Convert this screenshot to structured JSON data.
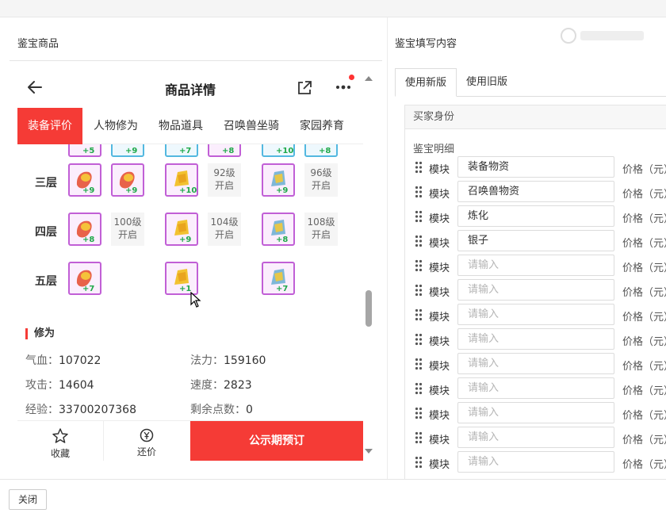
{
  "left_panel": {
    "title": "鉴宝商品"
  },
  "right_panel": {
    "title": "鉴宝填写内容"
  },
  "phone": {
    "nav_title": "商品详情",
    "tabs": [
      "装备评价",
      "人物修为",
      "物品道具",
      "召唤兽坐骑",
      "家园养育"
    ],
    "active_tab": "装备评价",
    "rows": [
      {
        "label": "",
        "items": [
          "+5",
          "+9",
          "+7",
          "+8",
          "+10",
          "+8"
        ]
      },
      {
        "label": "三层",
        "items": [
          "+9",
          "+9",
          "+10",
          "+9"
        ],
        "locked": [
          "92级开启",
          "96级开启"
        ]
      },
      {
        "label": "四层",
        "items": [
          "+8",
          "+9",
          "+8"
        ],
        "locked": [
          "100级开启",
          "104级开启",
          "108级开启"
        ]
      },
      {
        "label": "五层",
        "items": [
          "+7",
          "+1",
          "+7"
        ]
      }
    ],
    "locked_lines": {
      "l92": [
        "92级",
        "开启"
      ],
      "l96": [
        "96级",
        "开启"
      ],
      "l100": [
        "100级",
        "开启"
      ],
      "l104": [
        "104级",
        "开启"
      ],
      "l108": [
        "108级",
        "开启"
      ]
    },
    "section_title": "修为",
    "stats": {
      "qixue_label": "气血：",
      "qixue": "107022",
      "fali_label": "法力：",
      "fali": "159160",
      "gongji_label": "攻击：",
      "gongji": "14604",
      "sudu_label": "速度：",
      "sudu": "2823",
      "jingyan_label": "经验：",
      "jingyan": "33700207368",
      "dianshu_label": "剩余点数：",
      "dianshu": "0"
    },
    "bottom": {
      "favorite": "收藏",
      "bargain": "还价",
      "book": "公示期预订"
    }
  },
  "form": {
    "tabs": [
      "使用新版",
      "使用旧版"
    ],
    "active_tab": "使用新版",
    "buyer_identity": "买家身份",
    "detail_title": "鉴宝明细",
    "module_label": "模块",
    "price_label": "价格（元）",
    "placeholder": "请输入",
    "rows": [
      {
        "value": "装备物资"
      },
      {
        "value": "召唤兽物资"
      },
      {
        "value": "炼化"
      },
      {
        "value": "银子"
      },
      {
        "value": ""
      },
      {
        "value": ""
      },
      {
        "value": ""
      },
      {
        "value": ""
      },
      {
        "value": ""
      },
      {
        "value": ""
      },
      {
        "value": ""
      },
      {
        "value": ""
      },
      {
        "value": ""
      }
    ]
  },
  "footer": {
    "close": "关闭"
  },
  "colors": {
    "accent": "#f53b36",
    "item_border_purple": "#c15fd6",
    "item_border_blue": "#53b8e0",
    "level_green": "#1fa94a"
  }
}
